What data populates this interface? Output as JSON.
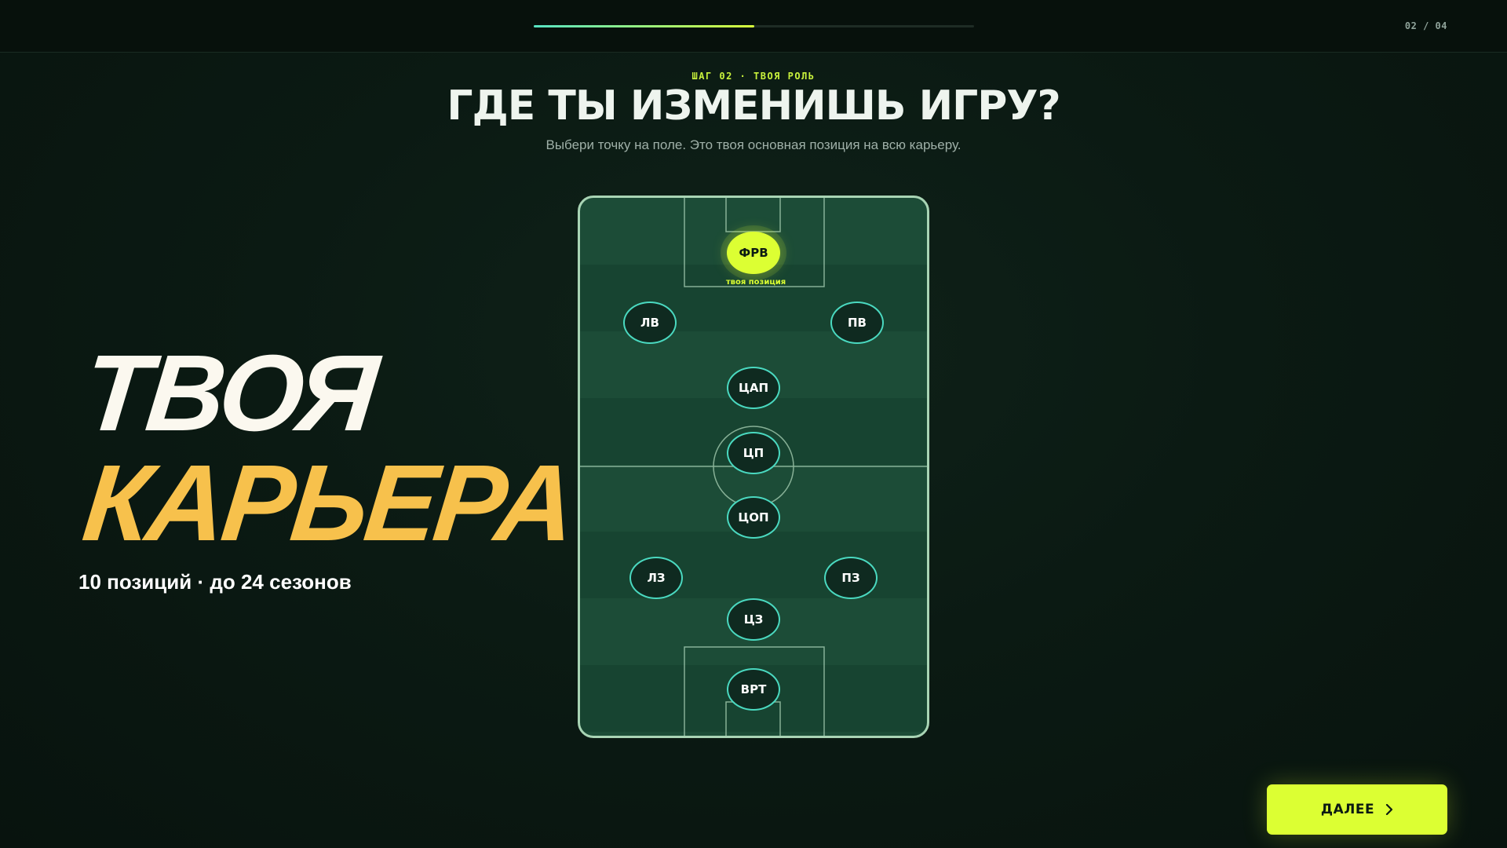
{
  "progress": {
    "step_counter": "02 / 04",
    "fraction": 0.5
  },
  "header": {
    "step_label": "ШАГ 02 · ТВОЯ РОЛЬ",
    "title": "ГДЕ ТЫ ИЗМЕНИШЬ ИГРУ?",
    "subtitle": "Выбери точку на поле. Это твоя основная позиция на всю карьеру."
  },
  "hero": {
    "line1": "ТВОЯ",
    "line2": "КАРЬЕРА",
    "sub": "10 позиций · до 24 сезонов"
  },
  "pitch": {
    "your_position_label": "твоя позиция",
    "positions": [
      {
        "id": "frv",
        "label": "ФРВ",
        "selected": true
      },
      {
        "id": "lv",
        "label": "ЛВ",
        "selected": false
      },
      {
        "id": "pv",
        "label": "ПВ",
        "selected": false
      },
      {
        "id": "cap",
        "label": "ЦАП",
        "selected": false
      },
      {
        "id": "cp",
        "label": "ЦП",
        "selected": false
      },
      {
        "id": "cop",
        "label": "ЦОП",
        "selected": false
      },
      {
        "id": "lz",
        "label": "ЛЗ",
        "selected": false
      },
      {
        "id": "pz",
        "label": "ПЗ",
        "selected": false
      },
      {
        "id": "cz",
        "label": "ЦЗ",
        "selected": false
      },
      {
        "id": "vrt",
        "label": "ВРТ",
        "selected": false
      }
    ]
  },
  "footer": {
    "next_label": "ДАЛЕЕ",
    "next_icon": "chevron-right-icon"
  },
  "colors": {
    "accent": "#dcff33",
    "hero_accent": "#f7c14c",
    "ring": "#4ad9c0"
  }
}
